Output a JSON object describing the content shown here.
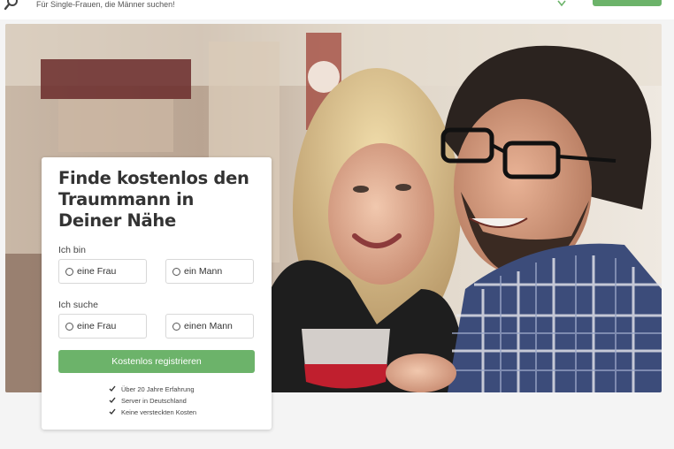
{
  "header": {
    "tagline": "Für Single-Frauen, die Männer suchen!",
    "logo_icon": "magnifier-heart-icon",
    "button_label": ""
  },
  "hero": {
    "image": "smiling couple photo"
  },
  "form": {
    "title": "Finde kostenlos den Traummann in Deiner Nähe",
    "i_am_label": "Ich bin",
    "i_am_options": [
      "eine Frau",
      "ein Mann"
    ],
    "looking_for_label": "Ich suche",
    "looking_for_options": [
      "eine Frau",
      "einen Mann"
    ],
    "submit_label": "Kostenlos registrieren",
    "benefits": [
      "Über 20 Jahre Erfahrung",
      "Server in Deutschland",
      "Keine versteckten Kosten"
    ],
    "accent_color": "#6cb36a"
  }
}
